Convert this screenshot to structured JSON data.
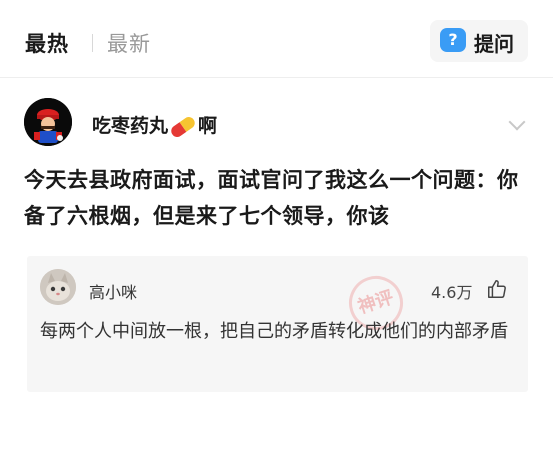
{
  "header": {
    "tab_hot": "最热",
    "tab_new": "最新",
    "ask_label": "提问",
    "ask_icon_char": "?"
  },
  "post": {
    "author": "吃枣药丸",
    "author_suffix": "啊",
    "author_emoji": "pill",
    "text": "今天去县政府面试，面试官问了我这么一个问题：你备了六根烟，但是来了七个领导，你该"
  },
  "comment": {
    "username": "高小咪",
    "likes": "4.6万",
    "text": "每两个人中间放一根，把自己的矛盾转化成他们的内部矛盾",
    "watermark": "神评"
  },
  "colors": {
    "accent_blue": "#3a9cf5",
    "pill_red": "#e53935",
    "pill_yellow": "#f6c431"
  }
}
